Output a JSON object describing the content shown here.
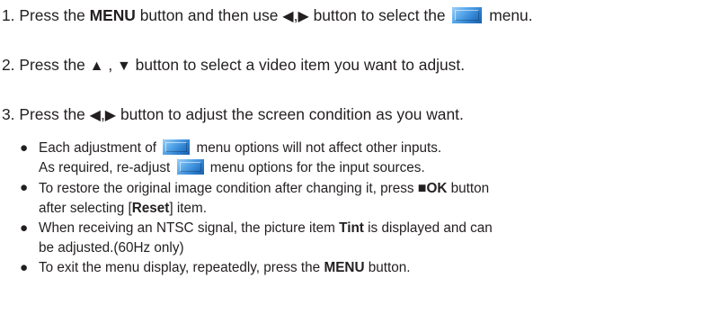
{
  "step1": {
    "number": "1.",
    "text_a": " Press the ",
    "menu_word": "MENU",
    "text_b": " button and then use ",
    "left_arrow": "◀",
    "comma": ",",
    "right_arrow": "▶",
    "text_c": " button to select the ",
    "text_d": " menu."
  },
  "step2": {
    "number": "2.",
    "text_a": " Press the ",
    "up_arrow": "▲",
    "comma": " , ",
    "down_arrow": "▼",
    "text_b": " button to select a video item you want to adjust."
  },
  "step3": {
    "number": "3.",
    "text_a": " Press the ",
    "left_arrow": "◀",
    "comma": ",",
    "right_arrow": "▶",
    "text_b": " button to adjust the screen condition as you want."
  },
  "notes": {
    "bullet": "●",
    "note1": {
      "line1_a": "Each adjustment of ",
      "line1_b": " menu options will not affect other inputs.",
      "line2_a": "As required, re-adjust ",
      "line2_b": " menu options for the input sources."
    },
    "note2": {
      "line1_a": "To restore the original image condition after changing it, press ",
      "square": "■",
      "ok": "OK",
      "line1_b": " button",
      "line2_a": "after selecting [",
      "reset": "Reset",
      "line2_b": "] item."
    },
    "note3": {
      "line1_a": "When receiving an NTSC signal, the picture item ",
      "tint": "Tint",
      "line1_b": " is displayed and can",
      "line2": "be adjusted.(60Hz only)"
    },
    "note4": {
      "text_a": "To exit the menu display, repeatedly, press the ",
      "menu_word": "MENU",
      "text_b": " button."
    }
  },
  "icons": {
    "menu_icon_color": "#2c7fd0"
  }
}
